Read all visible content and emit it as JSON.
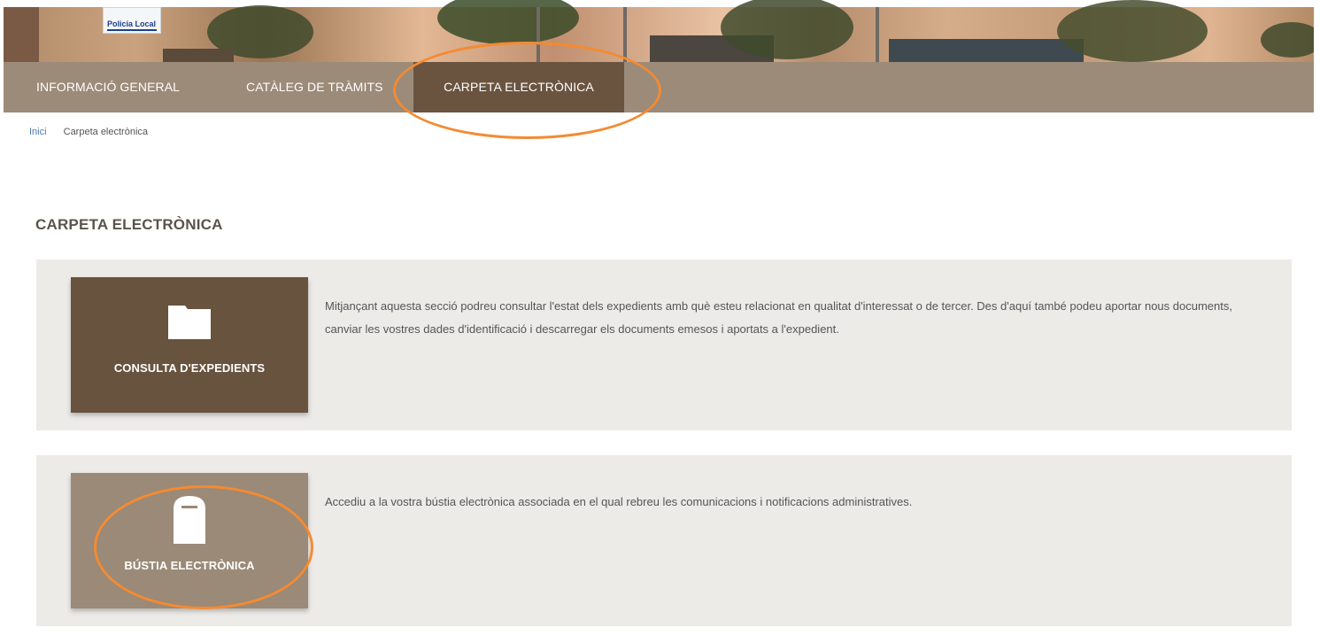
{
  "hero": {
    "sign_text": "Policia Local"
  },
  "nav": {
    "items": [
      {
        "label": "INFORMACIÓ GENERAL"
      },
      {
        "label": "CATÀLEG DE TRÀMITS"
      },
      {
        "label": "CARPETA ELECTRÒNICA"
      }
    ],
    "active_index": 2
  },
  "breadcrumb": {
    "home": "Inici",
    "current": "Carpeta electrònica"
  },
  "page_title": "CARPETA ELECTRÒNICA",
  "sections": [
    {
      "tile_label": "CONSULTA D'EXPEDIENTS",
      "icon": "folder-icon",
      "description": "Mitjançant aquesta secció podreu consultar l'estat dels expedients amb què esteu relacionat en qualitat d'interessat o de tercer. Des d'aquí també podeu aportar nous documents, canviar les vostres dades d'identificació i descarregar els documents emesos i aportats a l'expedient."
    },
    {
      "tile_label": "BÚSTIA ELECTRÒNICA",
      "icon": "mailbox-icon",
      "description": "Accediu a la vostra bústia electrònica associada en el qual rebreu les comunicacions i notificacions administratives."
    }
  ],
  "colors": {
    "nav_bg": "#9c8b79",
    "nav_active": "#6a5440",
    "tile_dark": "#67533e",
    "tile_light": "#9a8a77",
    "highlight": "#f58a31",
    "link": "#4a78b8"
  }
}
